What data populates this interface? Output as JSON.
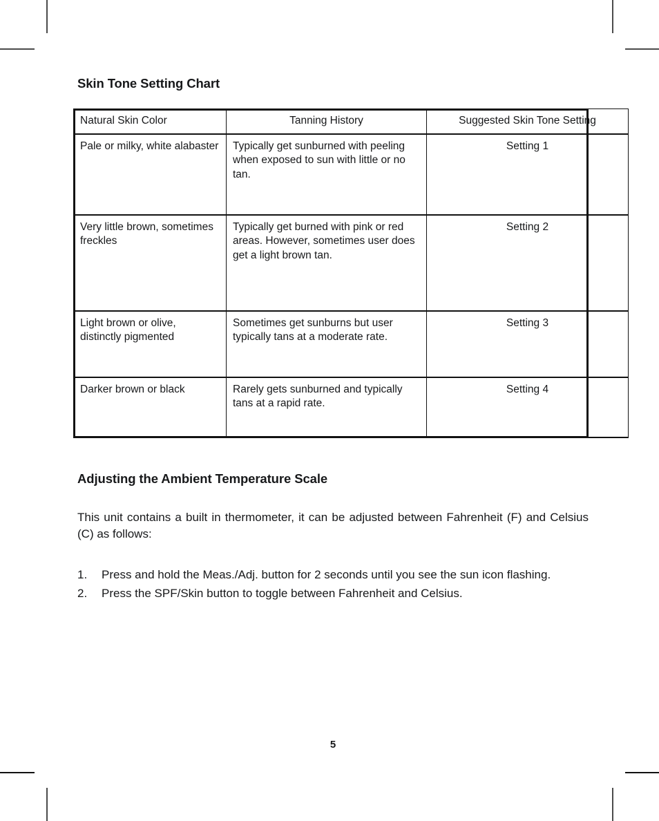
{
  "document": {
    "page_number": "5",
    "sections": {
      "chart_heading": "Skin Tone Setting Chart",
      "adjust_heading": "Adjusting the Ambient Temperature Scale"
    }
  },
  "table": {
    "headers": {
      "col1": "Natural Skin Color",
      "col2": "Tanning History",
      "col3": "Suggested Skin Tone Setting"
    },
    "rows": [
      {
        "skin_color": "Pale or milky, white alabaster",
        "tanning_history": "Typically get sunburned with peeling when exposed to sun with little or no tan.",
        "setting": "Setting 1"
      },
      {
        "skin_color": "Very little brown, sometimes freckles",
        "tanning_history": "Typically get burned with pink or red areas. However, sometimes user does get a light brown tan.",
        "setting": "Setting 2"
      },
      {
        "skin_color": "Light brown or olive, distinctly pigmented",
        "tanning_history": "Sometimes get sunburns but user typically tans at a moderate rate.",
        "setting": "Setting 3"
      },
      {
        "skin_color": "Darker brown or black",
        "tanning_history": "Rarely gets sunburned and typically tans at a rapid rate.",
        "setting": "Setting 4"
      }
    ]
  },
  "ambient": {
    "intro": "This unit contains a built in thermometer, it can be adjusted between Fahrenheit (F) and Celsius (C) as follows:",
    "steps": [
      {
        "num": "1.",
        "text": "Press and hold the Meas./Adj. button for 2 seconds until you see the sun icon flashing."
      },
      {
        "num": "2.",
        "text": "Press the SPF/Skin button to toggle between Fahrenheit and Celsius."
      }
    ]
  }
}
